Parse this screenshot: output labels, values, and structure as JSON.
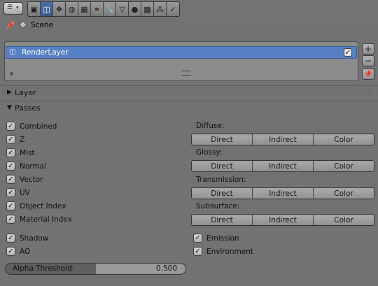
{
  "toolbar": {
    "editor_type_icon": "properties-editor-icon",
    "tabs": [
      {
        "name": "render-tab",
        "glyph": "▣"
      },
      {
        "name": "render-layers-tab",
        "glyph": "◫",
        "active": true
      },
      {
        "name": "scene-tab",
        "glyph": "❖"
      },
      {
        "name": "world-tab",
        "glyph": "◍"
      },
      {
        "name": "object-tab",
        "glyph": "▦"
      },
      {
        "name": "constraints-tab",
        "glyph": "⚭"
      },
      {
        "name": "modifiers-tab",
        "glyph": "🔧"
      },
      {
        "name": "data-tab",
        "glyph": "▽"
      },
      {
        "name": "material-tab",
        "glyph": "●"
      },
      {
        "name": "texture-tab",
        "glyph": "▩"
      },
      {
        "name": "particles-tab",
        "glyph": "⁂"
      },
      {
        "name": "physics-tab",
        "glyph": "✓"
      }
    ]
  },
  "breadcrumb": {
    "label": "Scene"
  },
  "render_layers": {
    "items": [
      {
        "label": "RenderLayer",
        "enabled": true
      }
    ],
    "add": "+",
    "remove": "−"
  },
  "panels": {
    "layer": {
      "title": "Layer",
      "collapsed": true
    },
    "passes": {
      "title": "Passes",
      "collapsed": false
    }
  },
  "passes": {
    "left": [
      {
        "label": "Combined",
        "checked": true
      },
      {
        "label": "Z",
        "checked": true
      },
      {
        "label": "Mist",
        "checked": true
      },
      {
        "label": "Normal",
        "checked": true
      },
      {
        "label": "Vector",
        "checked": true
      },
      {
        "label": "UV",
        "checked": true
      },
      {
        "label": "Object Index",
        "checked": true
      },
      {
        "label": "Material Index",
        "checked": true
      }
    ],
    "groups": [
      {
        "label": "Diffuse:",
        "buttons": [
          "Direct",
          "Indirect",
          "Color"
        ]
      },
      {
        "label": "Glossy:",
        "buttons": [
          "Direct",
          "Indirect",
          "Color"
        ]
      },
      {
        "label": "Transmission:",
        "buttons": [
          "Direct",
          "Indirect",
          "Color"
        ]
      },
      {
        "label": "Subsurface:",
        "buttons": [
          "Direct",
          "Indirect",
          "Color"
        ]
      }
    ],
    "shadow": {
      "label": "Shadow",
      "checked": true
    },
    "ao": {
      "label": "AO",
      "checked": true
    },
    "emission": {
      "label": "Emission",
      "checked": true
    },
    "environment": {
      "label": "Environment",
      "checked": true
    },
    "alpha_threshold": {
      "label": "Alpha Threshold:",
      "value": "0.500",
      "fraction": 0.5
    }
  }
}
